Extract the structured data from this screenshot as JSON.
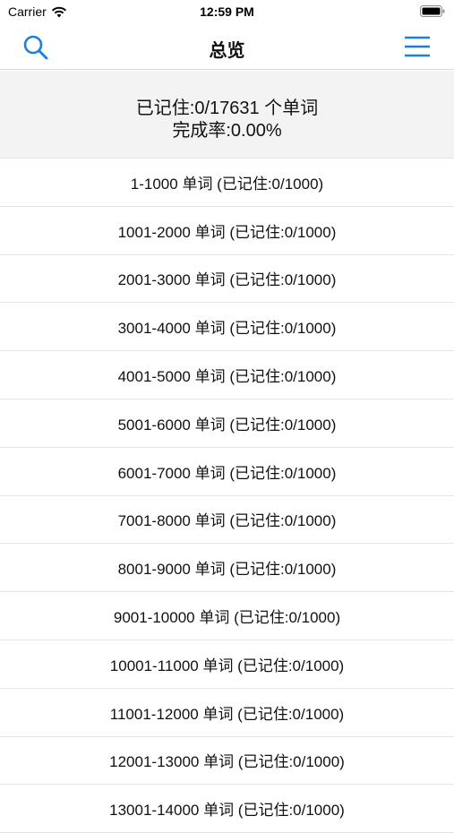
{
  "status": {
    "carrier": "Carrier",
    "time": "12:59 PM"
  },
  "nav": {
    "title": "总览",
    "search_icon": "search-icon",
    "menu_icon": "hamburger-menu-icon",
    "accent": "#1a7fe0"
  },
  "summary": {
    "line1": "已记住:0/17631 个单词",
    "line2": "完成率:0.00%"
  },
  "list": [
    "1-1000 单词 (已记住:0/1000)",
    "1001-2000 单词 (已记住:0/1000)",
    "2001-3000 单词 (已记住:0/1000)",
    "3001-4000 单词 (已记住:0/1000)",
    "4001-5000 单词 (已记住:0/1000)",
    "5001-6000 单词 (已记住:0/1000)",
    "6001-7000 单词 (已记住:0/1000)",
    "7001-8000 单词 (已记住:0/1000)",
    "8001-9000 单词 (已记住:0/1000)",
    "9001-10000 单词 (已记住:0/1000)",
    "10001-11000 单词 (已记住:0/1000)",
    "11001-12000 单词 (已记住:0/1000)",
    "12001-13000 单词 (已记住:0/1000)",
    "13001-14000 单词 (已记住:0/1000)"
  ]
}
